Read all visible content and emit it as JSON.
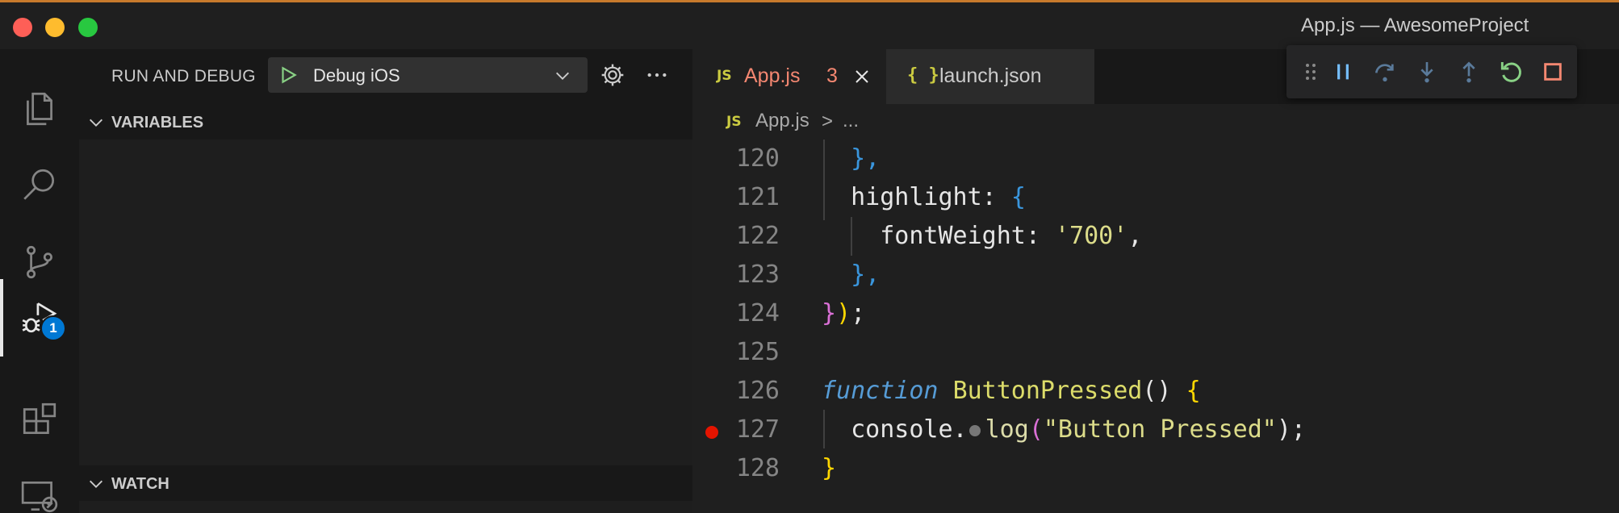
{
  "window": {
    "title": "App.js — AwesomeProject"
  },
  "sidebar": {
    "title": "RUN AND DEBUG",
    "config": "Debug iOS",
    "sections": {
      "variables": "VARIABLES",
      "watch": "WATCH"
    }
  },
  "activity": {
    "debug_badge": "1"
  },
  "tabs": [
    {
      "icon": "JS",
      "label": "App.js",
      "problems": "3",
      "active": true
    },
    {
      "icon": "{ }",
      "label": "launch.json",
      "active": false
    }
  ],
  "breadcrumb": {
    "icon": "JS",
    "file": "App.js",
    "separator": ">",
    "rest": "..."
  },
  "code": {
    "line_numbers": [
      "120",
      "121",
      "122",
      "123",
      "124",
      "125",
      "126",
      "127",
      "128"
    ],
    "tokens": {
      "l120_a": "},",
      "l121_a": "highlight: ",
      "l121_b": "{",
      "l122_a": "fontWeight: ",
      "l122_b": "'700'",
      "l122_c": ",",
      "l123_a": "},",
      "l124_a": "}",
      "l124_b": ")",
      "l124_c": ";",
      "l126_a": "function",
      "l126_b": "ButtonPressed",
      "l126_c": "() ",
      "l126_d": "{",
      "l127_a": "console.",
      "l127_b": "log",
      "l127_c": "(",
      "l127_d": "\"Button Pressed\"",
      "l127_e": ");",
      "l128_a": "}"
    }
  },
  "colors": {
    "accent_top": "#c77a2c",
    "error": "#f48771",
    "breakpoint": "#e51400",
    "badge": "#0078d4"
  }
}
